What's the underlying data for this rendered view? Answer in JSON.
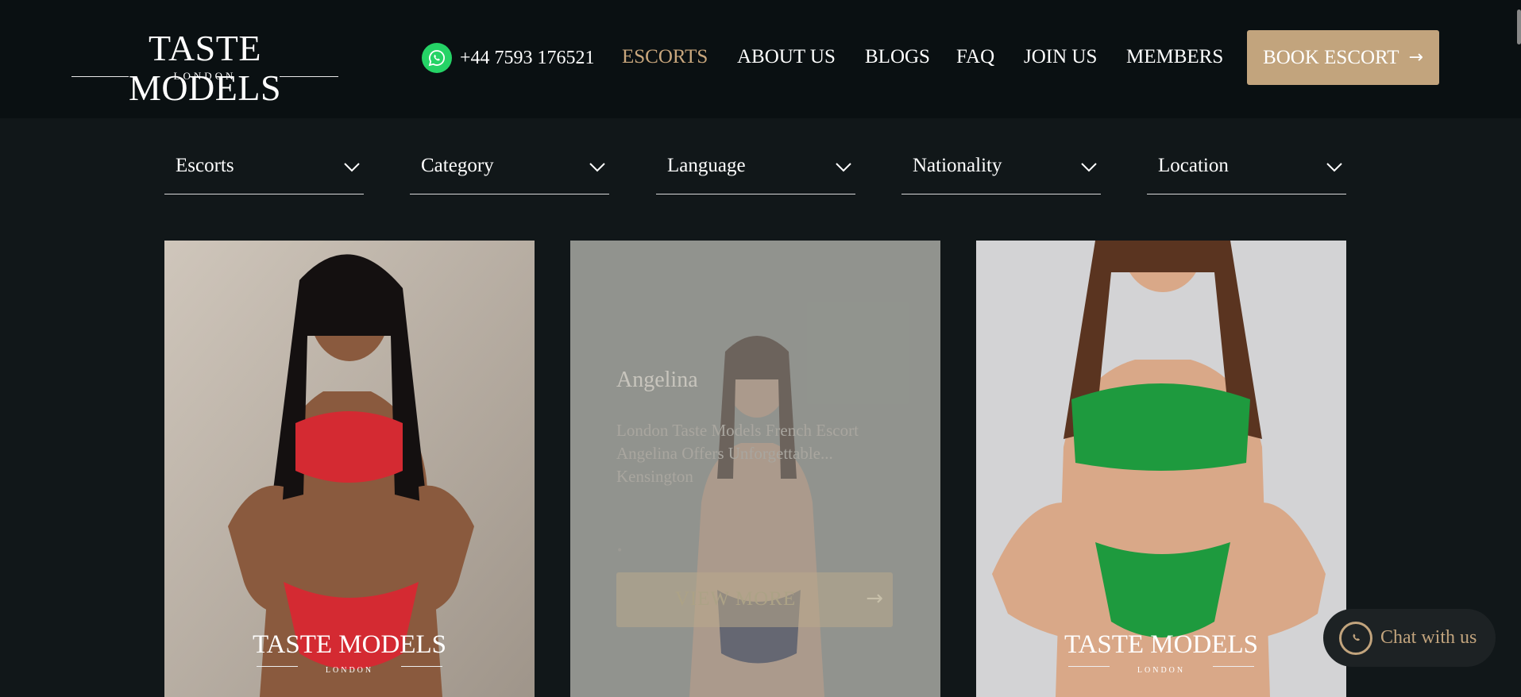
{
  "header": {
    "logo": {
      "main": "TASTE MODELS",
      "sub": "LONDON"
    },
    "phone": "+44 7593 176521",
    "nav": [
      {
        "label": "ESCORTS",
        "active": true
      },
      {
        "label": "ABOUT US",
        "active": false
      },
      {
        "label": "BLOGS",
        "active": false
      },
      {
        "label": "FAQ",
        "active": false
      },
      {
        "label": "JOIN US",
        "active": false
      },
      {
        "label": "MEMBERS",
        "active": false
      }
    ],
    "book_button": "BOOK ESCORT"
  },
  "filters": [
    "Escorts",
    "Category",
    "Language",
    "Nationality",
    "Location"
  ],
  "cards": [
    {
      "watermark_main": "TASTE MODELS",
      "watermark_sub": "LONDON"
    },
    {
      "name": "Angelina",
      "description": "London Taste Models French Escort Angelina Offers Unforgettable... Kensington",
      "dot": "•",
      "button": "VIEW MORE"
    },
    {
      "watermark_main": "TASTE MODELS",
      "watermark_sub": "LONDON"
    }
  ],
  "chat": {
    "label": "Chat with us"
  },
  "colors": {
    "accent": "#c2a47d",
    "header_bg": "#0a1012",
    "page_bg": "#111719",
    "whatsapp": "#25d366"
  }
}
